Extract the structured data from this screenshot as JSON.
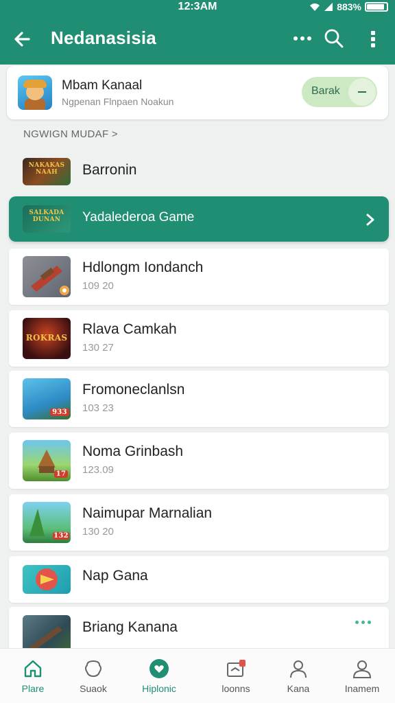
{
  "status_bar": {
    "time": "12:3AM",
    "battery": "883%",
    "battery_level": 0.88
  },
  "app_bar": {
    "title": "Nedanasisia"
  },
  "profile": {
    "name": "Mbam Kanaal",
    "subtitle": "Ngpenan Flnpaen Noakun",
    "toggle_label": "Barak"
  },
  "section": {
    "header": "NGWIGN MUDAF >"
  },
  "games": [
    {
      "title": "Barronin",
      "subtitle": "",
      "thumb_text": "NAKAKAS NAAH"
    },
    {
      "title": "Yadalederoa Game",
      "subtitle": "",
      "thumb_text": "SALKADA DUNAN",
      "selected": true
    },
    {
      "title": "Hdlongm Iondanch",
      "subtitle": "109 20"
    },
    {
      "title": "Rlava Camkah",
      "subtitle": "130 27",
      "thumb_text": "ROKRAS"
    },
    {
      "title": "Fromoneclanlsn",
      "subtitle": "103 23",
      "thumb_text": "933"
    },
    {
      "title": "Noma Grinbash",
      "subtitle": "123.09",
      "thumb_text": "17"
    },
    {
      "title": "Naimupar Marnalian",
      "subtitle": "130 20",
      "thumb_text": "132"
    },
    {
      "title": "Nap Gana",
      "subtitle": ""
    },
    {
      "title": "Briang Kanana",
      "subtitle": ""
    }
  ],
  "bottom_nav": [
    {
      "label": "Plare",
      "icon": "home-icon",
      "active": true
    },
    {
      "label": "Suaok",
      "icon": "chat-bubble-icon"
    },
    {
      "label": "Hiplonic",
      "icon": "heart-badge-icon"
    },
    {
      "label": "loonns",
      "icon": "inbox-icon"
    },
    {
      "label": "Kana",
      "icon": "user-icon"
    },
    {
      "label": "Inamem",
      "icon": "profile-icon"
    }
  ],
  "colors": {
    "primary": "#1f8e73",
    "toggle_bg": "#cde9c4",
    "accent_dot": "#43b694",
    "badge": "#e2544b"
  }
}
